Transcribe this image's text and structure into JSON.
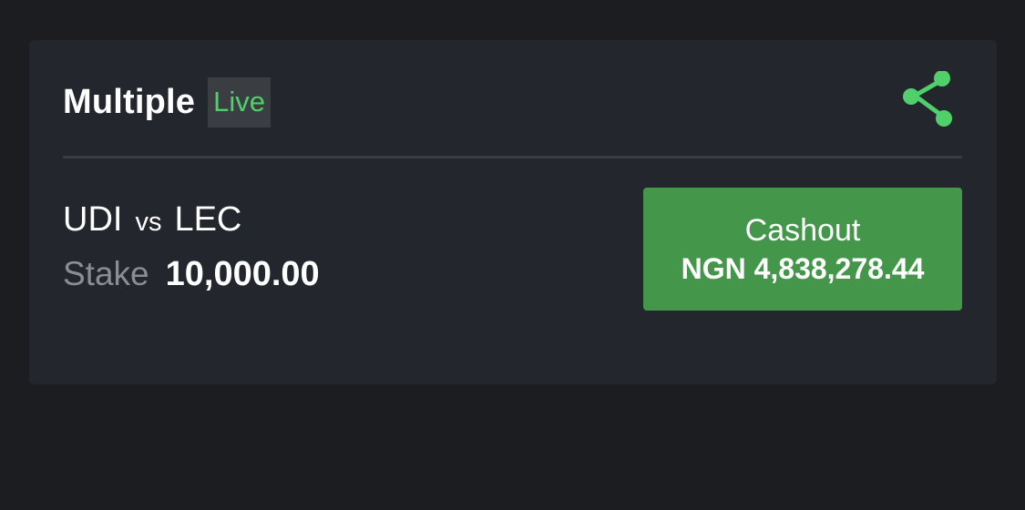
{
  "bet": {
    "title": "Multiple",
    "live_badge": "Live",
    "share_icon": "share-icon",
    "match": {
      "home": "UDI",
      "vs": "vs",
      "away": "LEC"
    },
    "stake": {
      "label": "Stake",
      "value": "10,000.00"
    },
    "cashout": {
      "label": "Cashout",
      "amount": "NGN 4,838,278.44"
    }
  },
  "colors": {
    "page_bg": "#1c1d21",
    "card_bg": "#23262d",
    "accent_green": "#4fd06a",
    "button_green": "#43964a",
    "muted_text": "#8a8d93"
  }
}
